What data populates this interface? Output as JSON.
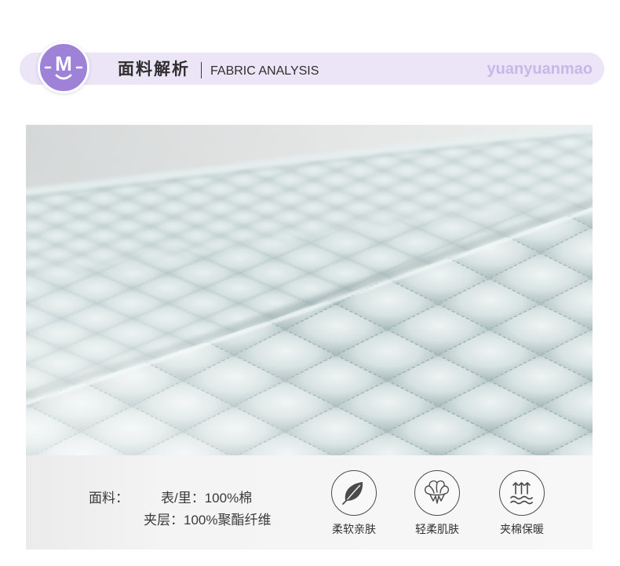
{
  "header": {
    "title_cn": "面料解析",
    "title_en": "FABRIC ANALYSIS",
    "brand": "yuanyuanmao",
    "logo": {
      "letter": "M",
      "icon": "smiley-m-logo"
    }
  },
  "fabric": {
    "label": "面料：",
    "outer_inner": "表/里：100%棉",
    "interlayer": "夹层：100%聚酯纤维"
  },
  "features": [
    {
      "icon": "leaf-icon",
      "label": "柔软亲肤"
    },
    {
      "icon": "cotton-boll-icon",
      "label": "轻柔肌肤"
    },
    {
      "icon": "warmth-waves-icon",
      "label": "夹棉保暖"
    }
  ],
  "colors": {
    "accent": "#9d82d8",
    "header_bg": "#ebe5f7",
    "brand_text": "#c7b8ea",
    "text": "#2f2f2f",
    "fabric": "#d6e1e1",
    "fabric_seam": "#a9bbbb"
  }
}
